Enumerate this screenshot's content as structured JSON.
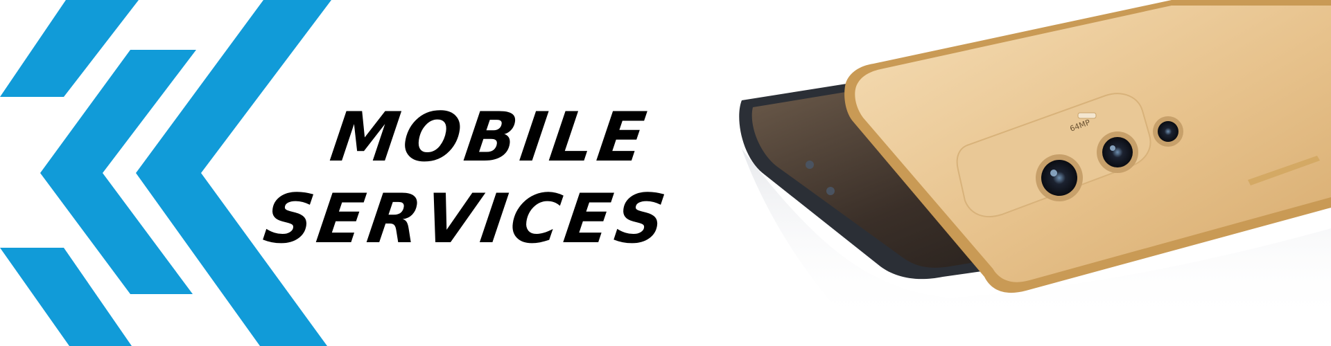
{
  "banner": {
    "headline_line1": "MOBILE",
    "headline_line2": "SERVICES",
    "camera_label": "64MP",
    "colors": {
      "accent_blue": "#119BD8",
      "text": "#000000",
      "phone_gold": "#E7C28C",
      "phone_dark": "#2B2F36"
    },
    "icons": [
      "chevron-left-logo",
      "smartphone-illustration"
    ]
  }
}
